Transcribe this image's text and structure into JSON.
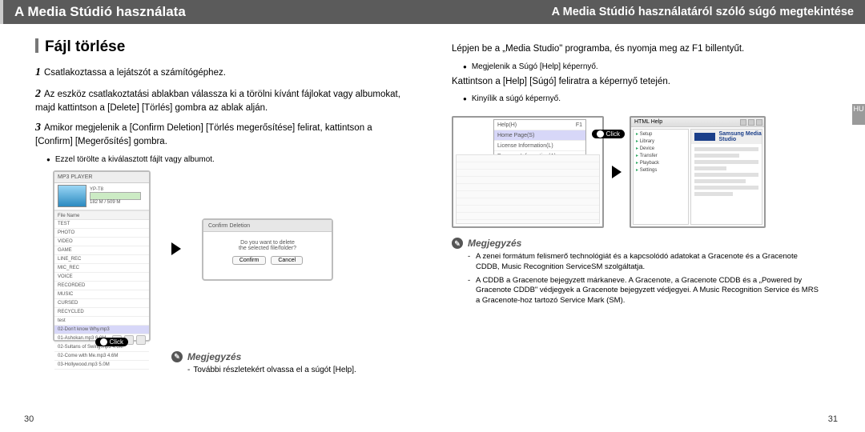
{
  "left": {
    "header": "A Media Stúdió használata",
    "section_title": "Fájl törlése",
    "step1": "Csatlakoztassa a lejátszót a számítógéphez.",
    "step2": "Az eszköz csatlakoztatási ablakban válassza ki a törölni kívánt fájlokat vagy albumokat, majd kattintson a [Delete] [Törlés]        gombra az ablak alján.",
    "step3": "Amikor megjelenik a [Confirm Deletion] [Törlés megerősítése] felirat, kattintson a [Confirm] [Megerősítés] gombra.",
    "bullet3": "Ezzel törölte a kiválasztott fájlt vagy albumot.",
    "mp3": {
      "title": "MP3 PLAYER",
      "device": "YP-T8",
      "progress": "182 M / 509 M",
      "header": "File Name",
      "rows": [
        "TEST",
        "PHOTO",
        "VIDEO",
        "GAME",
        "LINE_REC",
        "MIC_REC",
        "VOICE",
        "RECORDED",
        "MUSIC",
        "CURSED",
        "RECYCLED",
        "test"
      ],
      "sel": "02-Don't know Why.mp3",
      "files": [
        "01-Ashokan.mp3  6.0M",
        "02-Sultans of Swing.mp3  4.6M",
        "02-Come with Me.mp3  4.6M",
        "03-Hollywood.mp3  5.0M"
      ]
    },
    "confirm": {
      "title": "Confirm Deletion",
      "msg1": "Do you want to delete",
      "msg2": "the selected file/folder?",
      "btnConfirm": "Confirm",
      "btnCancel": "Cancel"
    },
    "click": "Click",
    "note_label": "Megjegyzés",
    "note_text": "További részletekért olvassa el a súgót [Help].",
    "pagenum": "30"
  },
  "right": {
    "header": "A Media Stúdió használatáról szóló súgó megtekintése",
    "line1": "Lépjen be a „Media Studio\" programba, és nyomja meg az F1 billentyűt.",
    "bullet1": "Megjelenik a Súgó [Help] képernyő.",
    "line2": "Kattintson a [Help] [Súgó] feliratra a képernyő tetején.",
    "bullet2": "Kinyílik a súgó képernyő.",
    "menu": {
      "items": [
        {
          "label": "Help(H)",
          "sc": "F1",
          "sel": false
        },
        {
          "label": "Home Page(S)",
          "sc": "",
          "sel": true
        },
        {
          "label": "License Information(L)",
          "sc": "",
          "sel": false
        },
        {
          "label": "Program Information(A)",
          "sc": "",
          "sel": false
        }
      ]
    },
    "click": "Click",
    "help_win_title": "HTML Help",
    "help_logo_text": "Samsung Media Studio",
    "note_label": "Megjegyzés",
    "note_items": [
      "A zenei formátum felismerő technológiát és a kapcsolódó adatokat a Gracenote és a Gracenote CDDB, Music Recognition ServiceSM szolgáltatja.",
      "A CDDB a Gracenote bejegyzett márkaneve. A Gracenote, a Gracenote CDDB és a „Powered by Gracenote CDDB\" védjegyek a Gracenote bejegyzett védjegyei. A Music Recognition Service és MRS a Gracenote-hoz tartozó Service Mark (SM)."
    ],
    "pagenum": "31",
    "sidetab": "HU"
  }
}
